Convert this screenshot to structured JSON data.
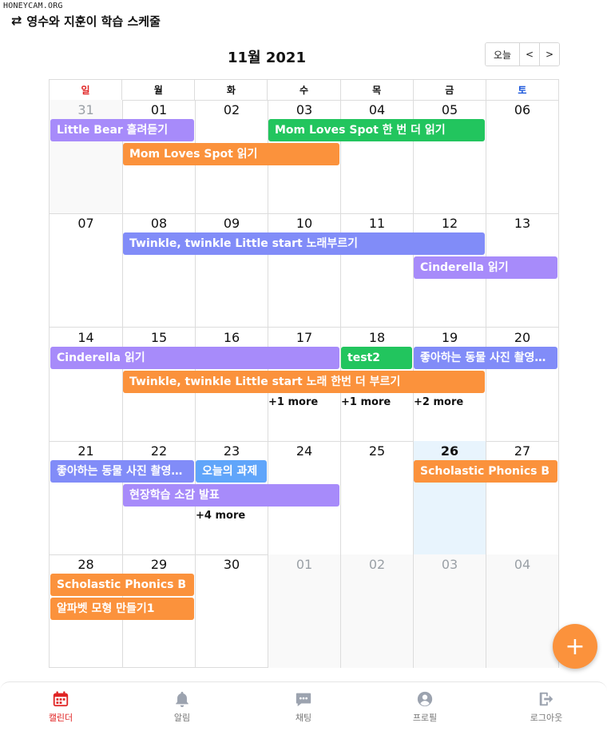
{
  "watermark": "HONEYCAM.ORG",
  "header": {
    "title": "영수와 지훈이 학습 스케줄",
    "swap_icon": "⇄"
  },
  "calendar_title": "11월 2021",
  "nav": {
    "today": "오늘",
    "prev": "<",
    "next": ">"
  },
  "weekdays": [
    "일",
    "월",
    "화",
    "수",
    "목",
    "금",
    "토"
  ],
  "weeks": [
    [
      "31",
      "01",
      "02",
      "03",
      "04",
      "05",
      "06"
    ],
    [
      "07",
      "08",
      "09",
      "10",
      "11",
      "12",
      "13"
    ],
    [
      "14",
      "15",
      "16",
      "17",
      "18",
      "19",
      "20"
    ],
    [
      "21",
      "22",
      "23",
      "24",
      "25",
      "26",
      "27"
    ],
    [
      "28",
      "29",
      "30",
      "01",
      "02",
      "03",
      "04"
    ]
  ],
  "other_month": {
    "first_week": [
      0
    ],
    "last_week": [
      3,
      4,
      5,
      6
    ]
  },
  "today": {
    "week": 3,
    "day": 5
  },
  "events": {
    "w0e1": "Little Bear 흘려듣기",
    "w0e2": "Mom Loves Spot 한 번 더 읽기",
    "w0e3": "Mom Loves Spot 읽기",
    "w1e1": "Twinkle, twinkle Little start 노래부르기",
    "w1e2": "Cinderella 읽기",
    "w2e1": "Cinderella 읽기",
    "w2e2": "test2",
    "w2e3": "좋아하는 동물 사진 촬영하기",
    "w2e4": "Twinkle, twinkle Little start 노래 한번 더 부르기",
    "w3e1": "좋아하는 동물 사진 촬영하기",
    "w3e2": "오늘의 과제",
    "w3e3": "Scholastic Phonics B",
    "w3e4": "현장학습 소감 발표",
    "w4e1": "Scholastic Phonics B",
    "w4e2": "알파벳 모형 만들기1"
  },
  "more": {
    "w2m1": "+1 more",
    "w2m2": "+1 more",
    "w2m3": "+2 more",
    "w3m1": "+4 more"
  },
  "fab": "+",
  "bottom_nav": [
    {
      "label": "캘린더",
      "icon": "calendar-icon"
    },
    {
      "label": "알림",
      "icon": "bell-icon"
    },
    {
      "label": "채팅",
      "icon": "chat-icon"
    },
    {
      "label": "프로필",
      "icon": "profile-icon"
    },
    {
      "label": "로그아웃",
      "icon": "logout-icon"
    }
  ],
  "colors": {
    "accent": "#fb923c",
    "purple": "#a78bfa",
    "indigo": "#818cf8",
    "green": "#22c55e",
    "blue": "#60a5fa",
    "active_nav": "#e02424"
  }
}
